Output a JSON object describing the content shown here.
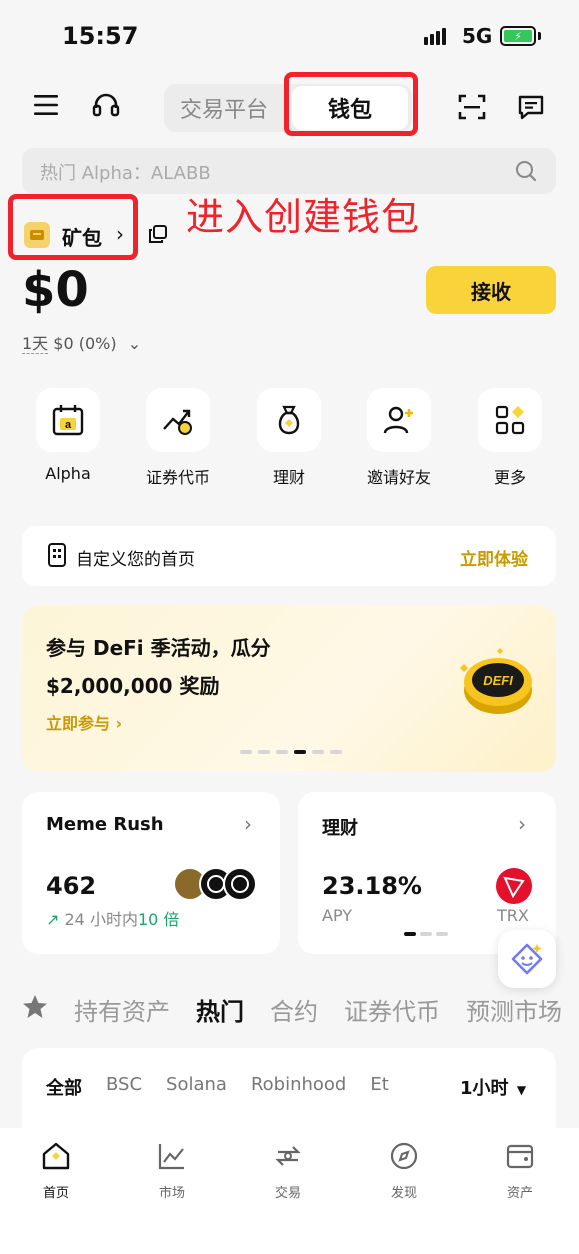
{
  "status_bar": {
    "time": "15:57",
    "network": "5G"
  },
  "header": {
    "segments": [
      {
        "label": "交易平台"
      },
      {
        "label": "钱包"
      }
    ],
    "search_placeholder": "热门 Alpha：ALABB"
  },
  "wallet": {
    "selector_label": "矿包",
    "balance": "$0",
    "pnl_period": "1天",
    "pnl_value": "$0 (0%)",
    "receive_label": "接收"
  },
  "annotation": "进入创建钱包",
  "quick_actions": [
    {
      "label": "Alpha",
      "icon": "alpha-calendar-icon"
    },
    {
      "label": "证券代币",
      "icon": "chart-coin-icon"
    },
    {
      "label": "理财",
      "icon": "money-bag-icon"
    },
    {
      "label": "邀请好友",
      "icon": "invite-user-icon"
    },
    {
      "label": "更多",
      "icon": "grid-more-icon"
    }
  ],
  "customize": {
    "label": "自定义您的首页",
    "cta": "立即体验"
  },
  "banner": {
    "line1": "参与 DeFi 季活动，瓜分",
    "line2": "$2,000,000 奖励",
    "cta": "立即参与",
    "coin_text": "DEFI"
  },
  "cards": {
    "meme": {
      "title": "Meme Rush",
      "value": "462",
      "sub_prefix": "24 小时内",
      "sub_highlight": "10 倍"
    },
    "earn": {
      "title": "理财",
      "value": "23.18%",
      "sub": "APY",
      "token": "TRX"
    }
  },
  "market_tabs": [
    "持有资产",
    "热门",
    "合约",
    "证券代币",
    "预测市场"
  ],
  "market_tab_active": "热门",
  "chains": [
    "全部",
    "BSC",
    "Solana",
    "Robinhood",
    "Et"
  ],
  "timeframe": "1小时",
  "tabbar": [
    {
      "label": "首页",
      "icon": "home-icon"
    },
    {
      "label": "市场",
      "icon": "chart-icon"
    },
    {
      "label": "交易",
      "icon": "swap-icon"
    },
    {
      "label": "发现",
      "icon": "discover-icon"
    },
    {
      "label": "资产",
      "icon": "wallet-icon"
    }
  ],
  "colors": {
    "accent": "#f8d33a",
    "highlight_red": "#f0222a",
    "gold_text": "#c99a00",
    "green": "#1aa56a",
    "trx_red": "#e5102b"
  }
}
